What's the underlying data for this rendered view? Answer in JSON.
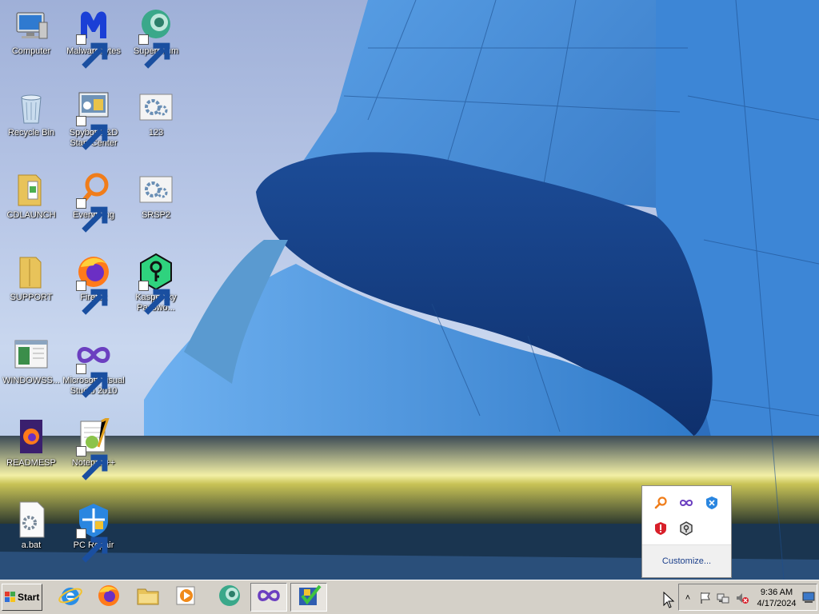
{
  "desktop": {
    "icons": [
      {
        "id": "computer",
        "label": "Computer",
        "shortcut": false,
        "icon": "computer-icon"
      },
      {
        "id": "malwarebytes",
        "label": "Malwarebytes",
        "shortcut": true,
        "icon": "malwarebytes-icon"
      },
      {
        "id": "supermium",
        "label": "Supermium",
        "shortcut": true,
        "icon": "supermium-icon"
      },
      {
        "id": "recycle-bin",
        "label": "Recycle Bin",
        "shortcut": false,
        "icon": "recycle-bin-icon"
      },
      {
        "id": "spybot",
        "label": "Spybot-S&D Start Center",
        "shortcut": true,
        "icon": "spybot-icon"
      },
      {
        "id": "file-123",
        "label": "123",
        "shortcut": false,
        "icon": "settings-file-icon"
      },
      {
        "id": "cdlaunch",
        "label": "CDLAUNCH",
        "shortcut": false,
        "icon": "folder-icon"
      },
      {
        "id": "everything",
        "label": "Everything",
        "shortcut": true,
        "icon": "everything-search-icon"
      },
      {
        "id": "srsp2",
        "label": "SRSP2",
        "shortcut": false,
        "icon": "settings-file-icon"
      },
      {
        "id": "support",
        "label": "SUPPORT",
        "shortcut": false,
        "icon": "folder-icon"
      },
      {
        "id": "firefox",
        "label": "Firefox",
        "shortcut": true,
        "icon": "firefox-icon"
      },
      {
        "id": "kaspersky",
        "label": "Kaspersky Passwo...",
        "shortcut": true,
        "icon": "kaspersky-password-icon"
      },
      {
        "id": "windowss",
        "label": "WINDOWSS...",
        "shortcut": false,
        "icon": "window-file-icon"
      },
      {
        "id": "vs2010",
        "label": "Microsoft Visual Studio 2010",
        "shortcut": true,
        "icon": "visual-studio-icon"
      },
      {
        "id": "readmesp",
        "label": "READMESP",
        "shortcut": false,
        "icon": "firefox-document-icon"
      },
      {
        "id": "notepadpp",
        "label": "Notepad++",
        "shortcut": true,
        "icon": "notepad-plus-plus-icon"
      },
      {
        "id": "abat",
        "label": "a.bat",
        "shortcut": false,
        "icon": "batch-file-icon"
      },
      {
        "id": "pcrepair",
        "label": "PC Repair",
        "shortcut": true,
        "icon": "pc-repair-icon"
      }
    ]
  },
  "tray_popup": {
    "icons": [
      "everything-tray-icon",
      "visual-studio-tray-icon",
      "supermium-tray-icon",
      "malwarebytes-tray-icon",
      "kaspersky-tray-icon"
    ],
    "customize_label": "Customize..."
  },
  "taskbar": {
    "start_label": "Start",
    "pinned": [
      {
        "id": "ie",
        "icon": "internet-explorer-icon",
        "active": false
      },
      {
        "id": "firefox",
        "icon": "firefox-icon",
        "active": false
      },
      {
        "id": "explorer",
        "icon": "file-explorer-icon",
        "active": false
      },
      {
        "id": "media",
        "icon": "media-player-icon",
        "active": false
      },
      {
        "id": "supermium",
        "icon": "supermium-icon",
        "active": false
      },
      {
        "id": "vs",
        "icon": "visual-studio-icon",
        "active": true
      },
      {
        "id": "installer",
        "icon": "installer-check-icon",
        "active": true
      }
    ],
    "tray": {
      "chevron": "˄",
      "time": "9:36 AM",
      "date": "4/17/2024"
    }
  }
}
